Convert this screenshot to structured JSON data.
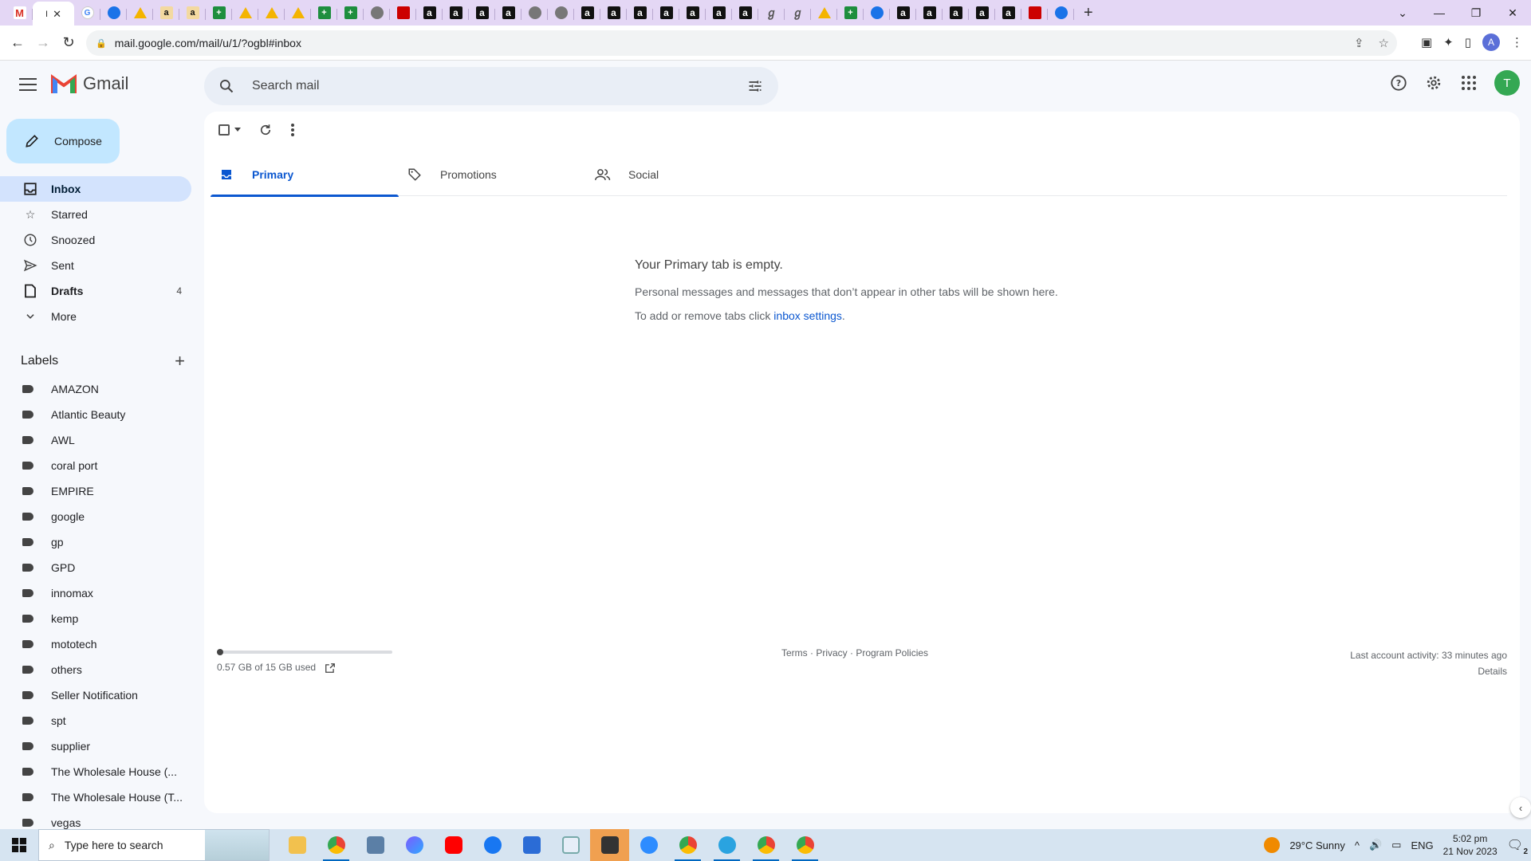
{
  "browser": {
    "active_tab_title": "I",
    "url": "mail.google.com/mail/u/1/?ogbl#inbox",
    "profile_initial": "A"
  },
  "gmail": {
    "brand": "Gmail",
    "search_placeholder": "Search mail",
    "user_initial": "T",
    "compose_label": "Compose",
    "nav": [
      {
        "label": "Inbox",
        "icon": "inbox-icon",
        "count": ""
      },
      {
        "label": "Starred",
        "icon": "star-icon",
        "count": ""
      },
      {
        "label": "Snoozed",
        "icon": "clock-icon",
        "count": ""
      },
      {
        "label": "Sent",
        "icon": "send-icon",
        "count": ""
      },
      {
        "label": "Drafts",
        "icon": "draft-icon",
        "count": "4"
      },
      {
        "label": "More",
        "icon": "chevron-down-icon",
        "count": ""
      }
    ],
    "labels_title": "Labels",
    "labels": [
      "AMAZON",
      "Atlantic Beauty",
      "AWL",
      "coral port",
      "EMPIRE",
      "google",
      "gp",
      "GPD",
      "innomax",
      "kemp",
      "mototech",
      "others",
      "Seller Notification",
      "spt",
      "supplier",
      "The Wholesale House (...",
      "The Wholesale House (T...",
      "vegas"
    ],
    "tabs": [
      {
        "label": "Primary",
        "icon": "inbox-icon"
      },
      {
        "label": "Promotions",
        "icon": "tag-icon"
      },
      {
        "label": "Social",
        "icon": "people-icon"
      }
    ],
    "empty": {
      "title": "Your Primary tab is empty.",
      "line1": "Personal messages and messages that don’t appear in other tabs will be shown here.",
      "line2_prefix": "To add or remove tabs click ",
      "line2_link": "inbox settings",
      "line2_suffix": "."
    },
    "storage_text": "0.57 GB of 15 GB used",
    "storage_fraction": 0.038,
    "footer_links": "Terms · Privacy · Program Policies",
    "last_activity": "Last account activity: 33 minutes ago",
    "details": "Details"
  },
  "taskbar": {
    "search_placeholder": "Type here to search",
    "weather": "29°C  Sunny",
    "lang": "ENG",
    "time": "5:02 pm",
    "date": "21 Nov 2023",
    "notifications": "2"
  },
  "colors": {
    "accent": "#0b57d0",
    "compose_bg": "#c2e7ff",
    "active_nav": "#d3e3fd",
    "tabstrip": "#e4d7f5"
  }
}
